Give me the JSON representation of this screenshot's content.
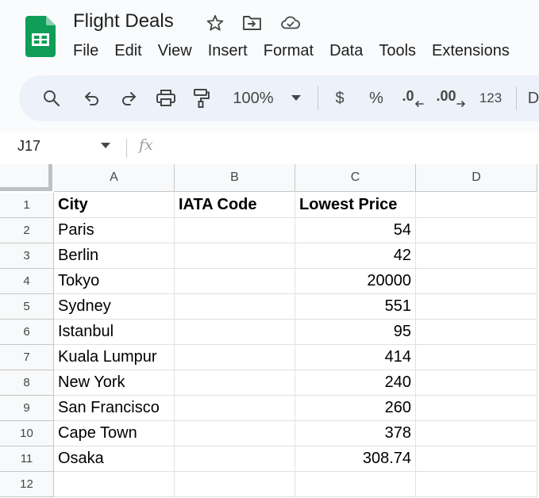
{
  "document": {
    "title": "Flight Deals"
  },
  "menu": [
    "File",
    "Edit",
    "View",
    "Insert",
    "Format",
    "Data",
    "Tools",
    "Extensions"
  ],
  "toolbar": {
    "zoom": "100%",
    "currency": "$",
    "percent": "%",
    "decrease_decimal": ".0",
    "increase_decimal": ".00",
    "number_format": "123",
    "more": "D"
  },
  "formula_bar": {
    "name_box": "J17",
    "fx": "fx",
    "value": ""
  },
  "sheet": {
    "columns": [
      "A",
      "B",
      "C",
      "D"
    ],
    "rows": [
      {
        "num": "1",
        "a": "City",
        "b": "IATA Code",
        "c": "Lowest Price",
        "d": ""
      },
      {
        "num": "2",
        "a": "Paris",
        "b": "",
        "c": "54",
        "d": ""
      },
      {
        "num": "3",
        "a": "Berlin",
        "b": "",
        "c": "42",
        "d": ""
      },
      {
        "num": "4",
        "a": "Tokyo",
        "b": "",
        "c": "20000",
        "d": ""
      },
      {
        "num": "5",
        "a": "Sydney",
        "b": "",
        "c": "551",
        "d": ""
      },
      {
        "num": "6",
        "a": "Istanbul",
        "b": "",
        "c": "95",
        "d": ""
      },
      {
        "num": "7",
        "a": "Kuala Lumpur",
        "b": "",
        "c": "414",
        "d": ""
      },
      {
        "num": "8",
        "a": "New York",
        "b": "",
        "c": "240",
        "d": ""
      },
      {
        "num": "9",
        "a": "San Francisco",
        "b": "",
        "c": "260",
        "d": ""
      },
      {
        "num": "10",
        "a": "Cape Town",
        "b": "",
        "c": "378",
        "d": ""
      },
      {
        "num": "11",
        "a": "Osaka",
        "b": "",
        "c": "308.74",
        "d": ""
      },
      {
        "num": "12",
        "a": "",
        "b": "",
        "c": "",
        "d": ""
      }
    ]
  },
  "colors": {
    "sheets_green": "#0f9d58",
    "toolbar_bg": "#edf2fa",
    "header_bg": "#f8f9fa"
  }
}
